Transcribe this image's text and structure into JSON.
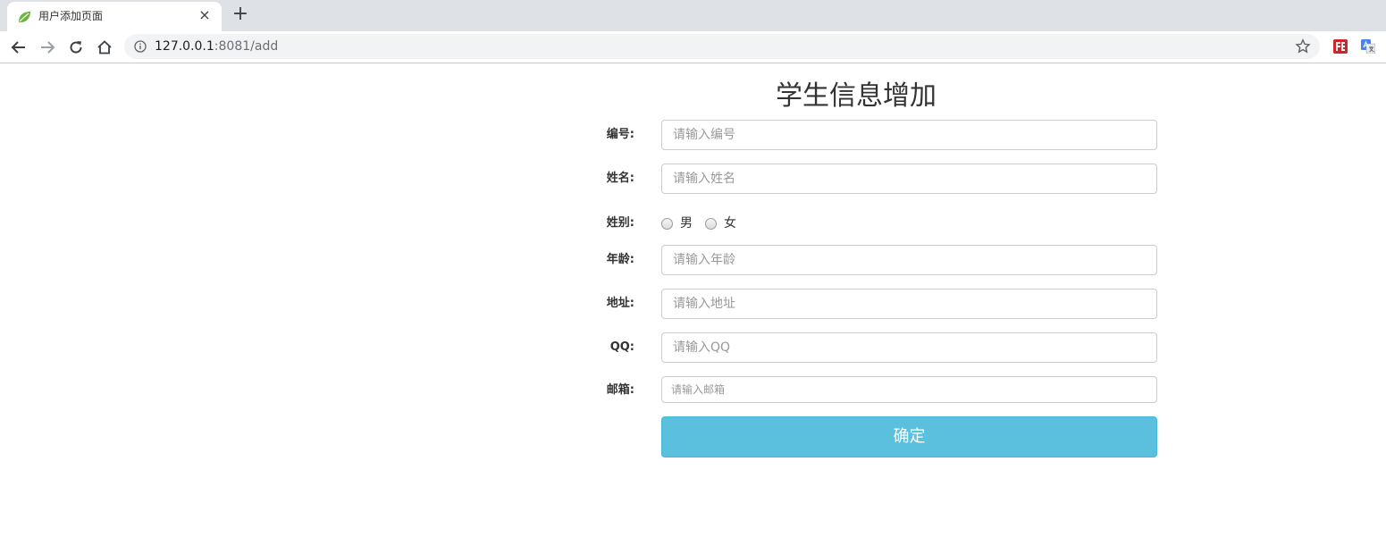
{
  "browser": {
    "tab_title": "用户添加页面",
    "tab_close": "×",
    "new_tab": "+",
    "url_host": "127.0.0.1",
    "url_rest": ":8081/add"
  },
  "form": {
    "title": "学生信息增加",
    "fields": {
      "id": {
        "label": "编号:",
        "placeholder": "请输入编号"
      },
      "name": {
        "label": "姓名:",
        "placeholder": "请输入姓名"
      },
      "gender": {
        "label": "姓别:",
        "option_male": "男",
        "option_female": "女"
      },
      "age": {
        "label": "年龄:",
        "placeholder": "请输入年龄"
      },
      "address": {
        "label": "地址:",
        "placeholder": "请输入地址"
      },
      "qq": {
        "label": "QQ:",
        "placeholder": "请输入QQ"
      },
      "email": {
        "label": "邮箱:",
        "placeholder": "请输入邮箱"
      }
    },
    "submit_label": "确定"
  },
  "colors": {
    "submit_bg": "#5bc0de",
    "tabbar_bg": "#dee1e6",
    "omnibox_bg": "#f1f3f4"
  }
}
